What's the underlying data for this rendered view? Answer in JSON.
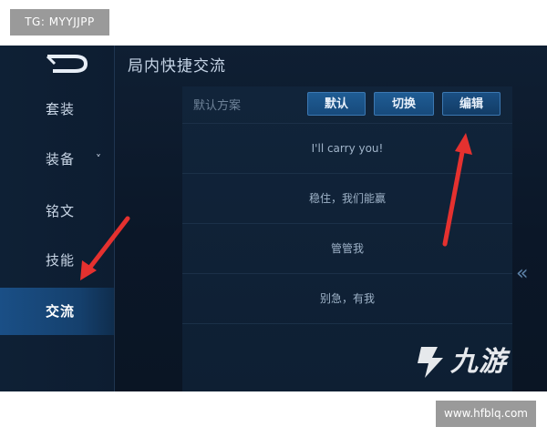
{
  "tg_label": "TG: MYYJJPP",
  "site_label": "www.hfblq.com",
  "title": "局内快捷交流",
  "sidebar": {
    "items": [
      {
        "label": "套装"
      },
      {
        "label": "装备",
        "chevron": "˅"
      },
      {
        "label": "铭文"
      },
      {
        "label": "技能"
      },
      {
        "label": "交流",
        "active": true
      }
    ]
  },
  "panel": {
    "scheme_label": "默认方案",
    "buttons": {
      "default": "默认",
      "switch": "切换",
      "edit": "编辑"
    },
    "phrases": [
      "I'll carry you!",
      "稳住，我们能赢",
      "管管我",
      "别急，有我"
    ]
  },
  "collapse_icon": "«",
  "watermark": {
    "text": "九游"
  },
  "colors": {
    "accent": "#1f5c94",
    "arrow": "#e5312f",
    "bg": "#0b1728"
  }
}
